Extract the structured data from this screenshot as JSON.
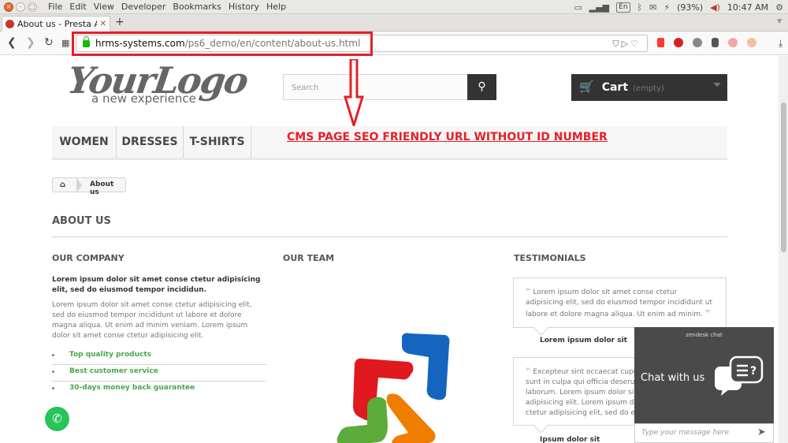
{
  "os": {
    "menus": [
      "File",
      "Edit",
      "View",
      "Developer",
      "Bookmarks",
      "History",
      "Help"
    ],
    "tray": {
      "lang": "En",
      "battery": "(93%)",
      "time": "10:47 AM"
    }
  },
  "browser": {
    "tab_title": "About us - Presta Ad",
    "new_tab": "+",
    "url_domain": "hrms-systems.com",
    "url_path": "/ps6_demo/en/content/about-us.html"
  },
  "annotation": {
    "text": "CMS PAGE SEO FRIENDLY URL WITHOUT ID NUMBER",
    "color": "#e52029"
  },
  "header": {
    "logo_main": "YourLogo",
    "logo_sub": "a new experience",
    "search_placeholder": "Search",
    "cart_label": "Cart",
    "cart_state": "(empty)"
  },
  "menu": [
    "WOMEN",
    "DRESSES",
    "T-SHIRTS"
  ],
  "breadcrumb": {
    "current": "About us"
  },
  "page": {
    "title": "ABOUT US",
    "company": {
      "heading": "OUR COMPANY",
      "lead": "Lorem ipsum dolor sit amet conse ctetur adipisicing elit, sed do eiusmod tempor incididun.",
      "body": "Lorem ipsum dolor sit amet conse ctetur adipisicing elit, sed do eiusmod tempor incididunt ut labore et dolore magna aliqua. Ut enim ad minim veniam. Lorem ipsum dolor sit amet conse ctetur adipisicing elit.",
      "bullets": [
        "Top quality products",
        "Best customer service",
        "30-days money back guarantee"
      ]
    },
    "team": {
      "heading": "OUR TEAM"
    },
    "testimonials": {
      "heading": "TESTIMONIALS",
      "items": [
        {
          "text": "Lorem ipsum dolor sit amet conse ctetur adipisicing elit, sed do eiusmod tempor incididunt ut labore et dolore magna aliqua. Ut enim ad minim.",
          "author": "Lorem ipsum dolor sit"
        },
        {
          "text": "Excepteur sint occaecat cupidatat non proident, sunt in culpa qui officia deserunt mollit anim id est laborum. Lorem ipsum dolor sit amet conse ctetur adipisicing elit. Lorem ipsum dolor sit amet conse ctetur adipisicing elit, sed do eiusmod.",
          "author": "Ipsum dolor sit"
        }
      ]
    }
  },
  "chat": {
    "brand": "zendesk chat",
    "title": "Chat with us",
    "placeholder": "Type your message here"
  }
}
